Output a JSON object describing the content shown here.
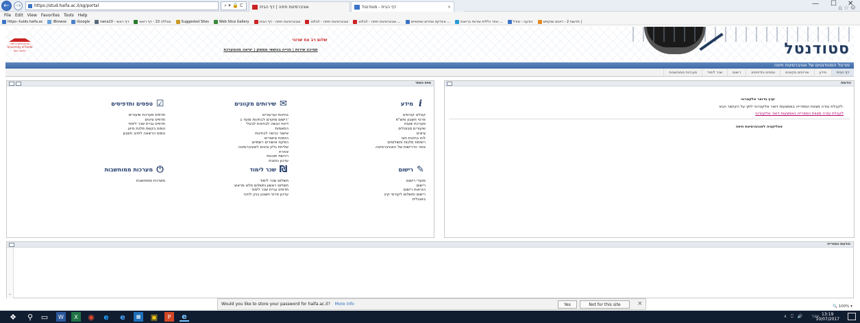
{
  "browser": {
    "address": "https://stud.haifa.ac.il/sg/portal",
    "address_controls": "⌕ ▾ 🔒 C",
    "tabs": [
      {
        "label": "אוניברסיטת חיפה | דף הבית"
      },
      {
        "label": "דף הבית - סטודנטל",
        "close": "×"
      }
    ],
    "new_tab": "",
    "window_controls": {
      "minimize": "—",
      "maximize": "☐",
      "close": "✕"
    },
    "right_icons": "⌂☆⚙",
    "menu": [
      "File",
      "Edit",
      "View",
      "Favorites",
      "Tools",
      "Help"
    ],
    "favorites": [
      {
        "label": "https--huids.haifa.ac",
        "color": "#3b73c6"
      },
      {
        "label": "iBrowse",
        "color": "#6aa0d8"
      },
      {
        "label": "iGoogle",
        "color": "#4a80c8"
      },
      {
        "label": "nana10 - דף ראשי",
        "color": "#5a6a7a"
      },
      {
        "label": "וואללה 10 - דף ראשי",
        "color": "#2a7a2a"
      },
      {
        "label": "Suggested Sites",
        "color": "#c89a20"
      },
      {
        "label": "Web Slice Gallery",
        "color": "#3a8a3a"
      },
      {
        "label": "אוניברסיטת חיפה - דף הבית",
        "color": "#c22"
      },
      {
        "label": "אוניברסיטת חיפה - לבלוט",
        "color": "#c22"
      },
      {
        "label": "אוניברסיטת חיפה - לבלוט ...",
        "color": "#c22"
      },
      {
        "label": "אינדקס אתרים שיתופיים ...",
        "color": "#3b73c6"
      },
      {
        "label": "אתר כללית שירותי בריאות ...",
        "color": "#2a9ad8"
      },
      {
        "label": "הודעה - מודל",
        "color": "#3b73c6"
      },
      {
        "label": "חדשות 2 - דיונים שוקפים |",
        "color": "#e08a20"
      }
    ]
  },
  "header": {
    "greeting": "שלום רב צח שרוני",
    "links": "תמיכה שירות | פנייה בנושאי ממשק | יציאה מהמערכת",
    "brand": "סטודנטל",
    "subtitle": "פורטל הסטודנטים של אוניברסיטת חיפה",
    "logo_lines": [
      "אוניברסיטת חיפה",
      "University of Haifa",
      "جامعة حيفا"
    ]
  },
  "nav_tabs": [
    {
      "label": "דף הבית",
      "active": true
    },
    {
      "label": "מידע",
      "active": false
    },
    {
      "label": "שירותים מקוונים",
      "active": false
    },
    {
      "label": "טפסים ותדפיסים",
      "active": false
    },
    {
      "label": "רישום",
      "active": false
    },
    {
      "label": "שכר לימוד",
      "active": false
    },
    {
      "label": "מערכות ממוחשבות",
      "active": false
    }
  ],
  "news": {
    "header": "הודעות",
    "title": "יעוץ בדואר אלקטרוני",
    "line1": "לקבלת עזרה מצוות הספרייה באמצעות דואר אלקטרוני לחץ על הקישור הבא:",
    "link": "לקבלת עזרה מצוות הספרייה באמצעות דואר אלקטרוני",
    "line3": "אפליקציה לאוניברסיטת חיפה"
  },
  "sitemap": {
    "header": "מפת האתר",
    "sections": [
      {
        "title": "מידע",
        "icon": "info-icon",
        "glyph": "i",
        "items": [
          "קטלוג קורסים",
          "פרטי חשבון ותש\"פ",
          "מערכת שעות",
          "שיעורים מבוטלים",
          "ציונים",
          "לוח בחינות חוגי",
          "רשימת מלגות ותשלומים",
          "אתר הדרישות של האוניברסיטה"
        ]
      },
      {
        "title": "שירותים מקוונים",
        "icon": "bag-icon",
        "glyph": "✉",
        "items": [
          "בחינות וערעורים",
          "רישום מוקדם לבחינות מועד ב'",
          "דיווח הגשה לבחינות לבעלי",
          "התאמות",
          "אישור כניסה לבחינות",
          "הזמנת אישורים",
          "הפקת אישורים רשמיים",
          "שליחת גליון ציונים לאוניברסיטה",
          "אחרת",
          "רכישת תוכנות",
          "עדכון כתובת"
        ]
      },
      {
        "title": "טפסים ותדפיסים",
        "icon": "clipboard-icon",
        "glyph": "☑",
        "items": [
          "תדפיס מערכת שיעורים",
          "תדפיס ציונים",
          "תדפיס גביית שכר לימוד",
          "טופס בקשת מלגת סיוע",
          "טופס הרשאה לחיוב חשבון"
        ]
      },
      {
        "title": "רישום",
        "icon": "pencil-icon",
        "glyph": "✎",
        "items": [
          "מועדי רישום",
          "רישום",
          "הוראות רישום",
          "רישום ותשלום לקורסי קיץ",
          "באנגלית"
        ]
      },
      {
        "title": "שכר לימוד",
        "icon": "shekel-icon",
        "glyph": "₪",
        "items": [
          "תשלום שכר לימוד",
          "תשלום ראשון ותשלום מלא מראש",
          "תדפיס גביית שכר לימוד",
          "עדכון פרטי חשבון בנק לזיכוי"
        ]
      },
      {
        "title": "מערכות ממוחשבות",
        "icon": "power-icon",
        "glyph": "⏻",
        "items": [
          "משרכת ממוחשבת"
        ]
      }
    ]
  },
  "library": {
    "header": "הודעות הספרייה"
  },
  "notification": {
    "question": "Would you like to store your password for haifa.ac.il?",
    "more": "More info",
    "yes": "Yes",
    "no": "Not for this site",
    "close": "×"
  },
  "zoom": "🔍 100%  ▾",
  "taskbar": {
    "time": "13:19",
    "date": "10/07/2017",
    "lang": "עבר",
    "tray_icons": "∧  ⎕  🔊"
  }
}
